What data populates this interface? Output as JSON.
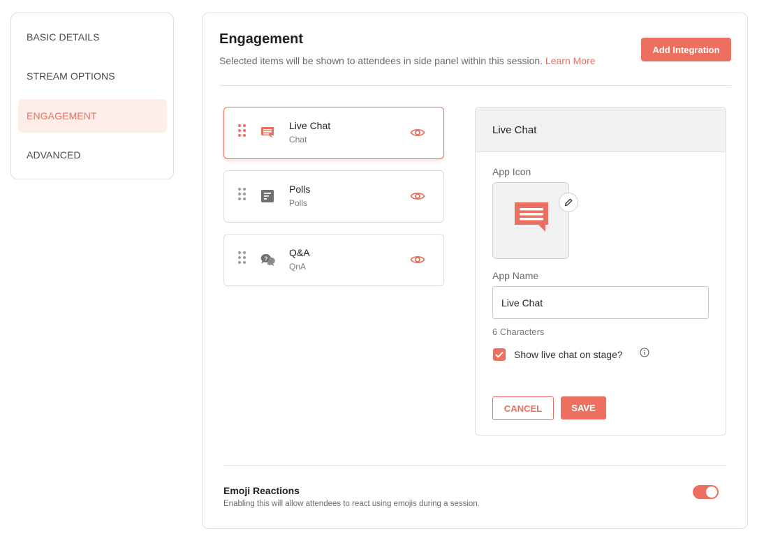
{
  "colors": {
    "accent": "#ec7060",
    "accent_light": "#fdeeea",
    "border": "#dcdcdc"
  },
  "sidebar": {
    "items": [
      {
        "label": "BASIC DETAILS",
        "active": false
      },
      {
        "label": "STREAM OPTIONS",
        "active": false
      },
      {
        "label": "ENGAGEMENT",
        "active": true
      },
      {
        "label": "ADVANCED",
        "active": false
      }
    ]
  },
  "header": {
    "title": "Engagement",
    "subtitle": "Selected items will be shown to attendees in side panel within this session.",
    "learn_more": "Learn More",
    "add_integration": "Add Integration"
  },
  "apps": [
    {
      "name": "Live Chat",
      "type": "Chat",
      "icon": "chat-icon",
      "selected": true,
      "visible": true
    },
    {
      "name": "Polls",
      "type": "Polls",
      "icon": "poll-icon",
      "selected": false,
      "visible": true
    },
    {
      "name": "Q&A",
      "type": "QnA",
      "icon": "qna-icon",
      "selected": false,
      "visible": true
    }
  ],
  "detail": {
    "title": "Live Chat",
    "app_icon_label": "App Icon",
    "app_icon": "chat-icon",
    "app_name_label": "App Name",
    "app_name_value": "Live Chat",
    "char_count": "6 Characters",
    "show_on_stage_label": "Show live chat on stage?",
    "show_on_stage_checked": true,
    "cancel": "CANCEL",
    "save": "SAVE"
  },
  "emoji": {
    "title": "Emoji Reactions",
    "description": "Enabling this will allow attendees to react using emojis during a session.",
    "enabled": true
  }
}
